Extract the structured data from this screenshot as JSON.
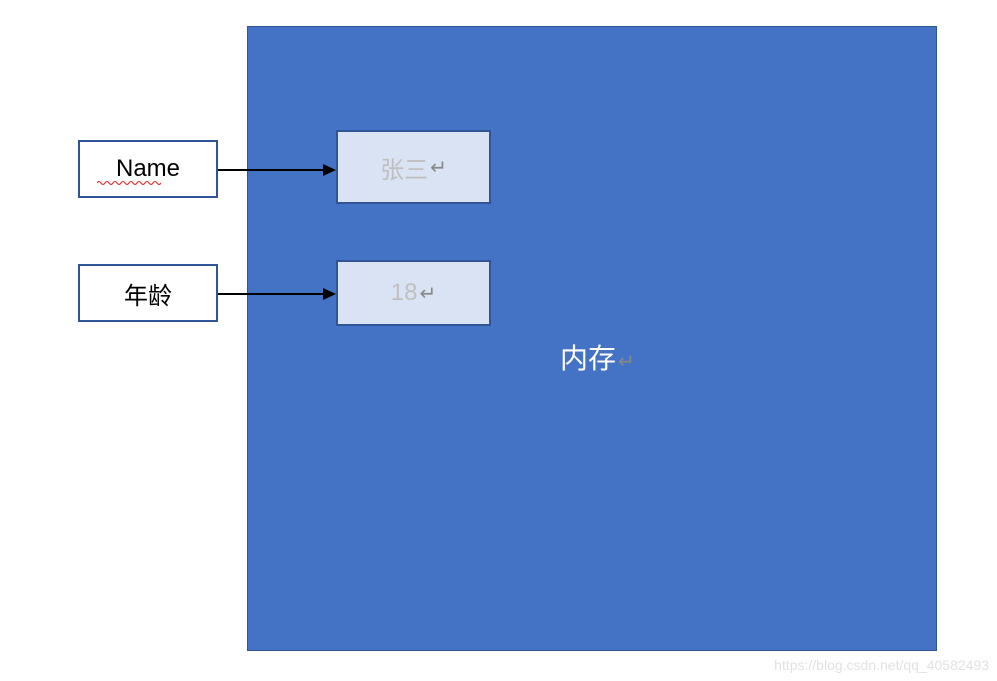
{
  "labels": {
    "name": "Name",
    "age": "年龄"
  },
  "values": {
    "name": "张三",
    "age": "18"
  },
  "memory_label": "内存",
  "return_symbol": "↵",
  "watermark": "https://blog.csdn.net/qq_40582493"
}
